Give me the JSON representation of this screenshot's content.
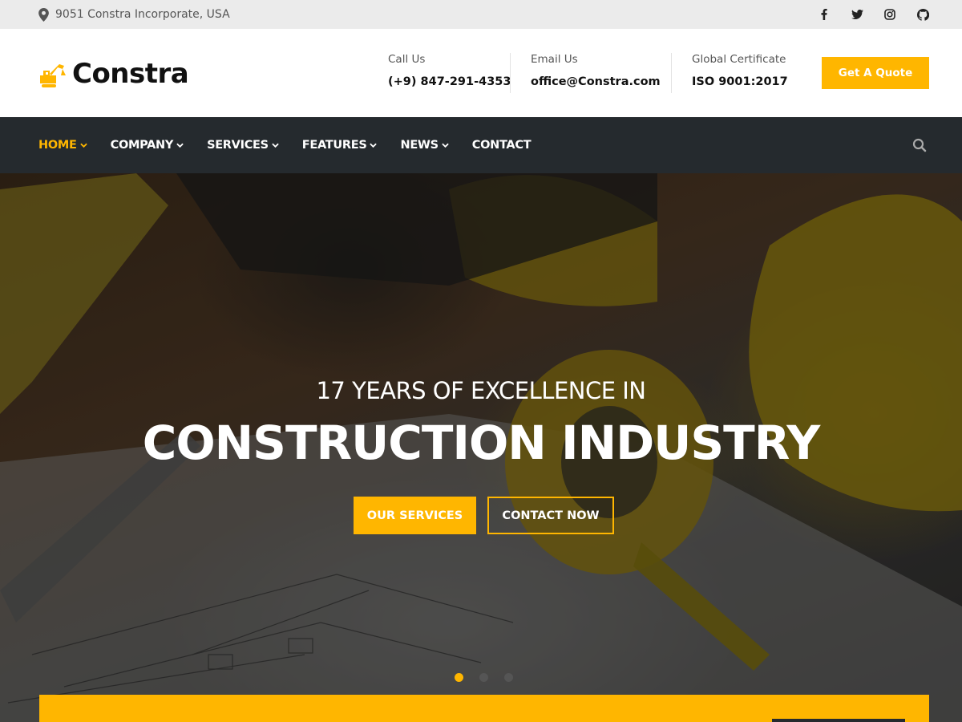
{
  "topbar": {
    "location_icon": "map-marker-icon",
    "location": "9051 Constra Incorporate, USA",
    "social": [
      "facebook-icon",
      "twitter-icon",
      "instagram-icon",
      "github-icon"
    ]
  },
  "header": {
    "logo_icon": "excavator-icon",
    "brand": "Constra",
    "call": {
      "label": "Call Us",
      "value": "(+9) 847-291-4353"
    },
    "email": {
      "label": "Email Us",
      "value": "office@Constra.com"
    },
    "cert": {
      "label": "Global Certificate",
      "value": "ISO 9001:2017"
    },
    "quote_button": "Get A Quote"
  },
  "nav": {
    "items": [
      {
        "label": "HOME",
        "dropdown": true,
        "active": true
      },
      {
        "label": "COMPANY",
        "dropdown": true
      },
      {
        "label": "SERVICES",
        "dropdown": true
      },
      {
        "label": "FEATURES",
        "dropdown": true
      },
      {
        "label": "NEWS",
        "dropdown": true
      },
      {
        "label": "CONTACT",
        "dropdown": false
      }
    ],
    "search_icon": "search-icon"
  },
  "hero": {
    "subtitle": "17 YEARS OF EXCELLENCE IN",
    "title": "CONSTRUCTION INDUSTRY",
    "primary_button": "OUR SERVICES",
    "secondary_button": "CONTACT NOW",
    "slides": 3,
    "active_slide": 1
  },
  "colors": {
    "accent": "#ffb600",
    "nav_bg": "#252a2e",
    "topbar_bg": "#ebebeb"
  }
}
